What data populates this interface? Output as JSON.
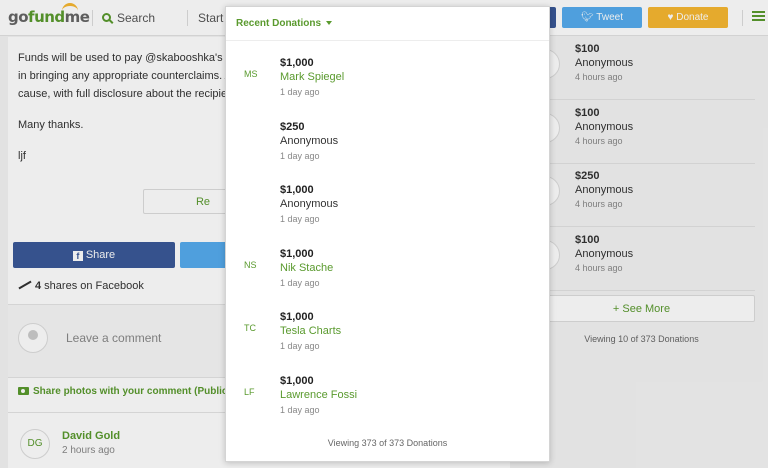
{
  "header": {
    "logo_go": "go",
    "logo_fund": "fund",
    "logo_me": "me",
    "search_label": "Search",
    "start_label": "Start a",
    "twitter_label": "Tweet",
    "donate_label": "Donate"
  },
  "story": {
    "line1": "Funds will be used to pay @skabooshka's lega",
    "line2": "in bringing any appropriate counterclaims. An",
    "line3": "cause, with full disclosure about the recipient",
    "thanks": "Many thanks.",
    "sign": "ljf",
    "read_more": "Re"
  },
  "share": {
    "facebook_label": "Share",
    "shares_count": "4",
    "shares_text": " shares on Facebook"
  },
  "comments": {
    "placeholder": "Leave a comment",
    "photos_label": "Share photos with your comment (Public)",
    "first": {
      "initials": "DG",
      "name": "David Gold",
      "time": "2 hours ago"
    }
  },
  "sidebar": {
    "donations": [
      {
        "amount": "$100",
        "name": "Anonymous",
        "time": "4 hours ago"
      },
      {
        "amount": "$100",
        "name": "Anonymous",
        "time": "4 hours ago"
      },
      {
        "amount": "$250",
        "name": "Anonymous",
        "time": "4 hours ago"
      },
      {
        "amount": "$100",
        "name": "Anonymous",
        "time": "4 hours ago"
      }
    ],
    "see_more": "See More",
    "viewing": "Viewing 10 of 373 Donations"
  },
  "modal": {
    "title": "Recent Donations",
    "donations": [
      {
        "initials": "MS",
        "amount": "$1,000",
        "name": "Mark Spiegel",
        "time": "1 day ago"
      },
      {
        "initials": "",
        "amount": "$250",
        "name": "Anonymous",
        "time": "1 day ago"
      },
      {
        "initials": "",
        "amount": "$1,000",
        "name": "Anonymous",
        "time": "1 day ago"
      },
      {
        "initials": "NS",
        "amount": "$1,000",
        "name": "Nik Stache",
        "time": "1 day ago"
      },
      {
        "initials": "TC",
        "amount": "$1,000",
        "name": "Tesla Charts",
        "time": "1 day ago"
      },
      {
        "initials": "LF",
        "amount": "$1,000",
        "name": "Lawrence Fossi",
        "time": "1 day ago"
      }
    ],
    "footer": "Viewing 373 of 373 Donations"
  },
  "colors": {
    "brand_green": "#5a9a2e",
    "facebook": "#3b5998",
    "twitter": "#55acee",
    "donate": "#f7b731"
  }
}
